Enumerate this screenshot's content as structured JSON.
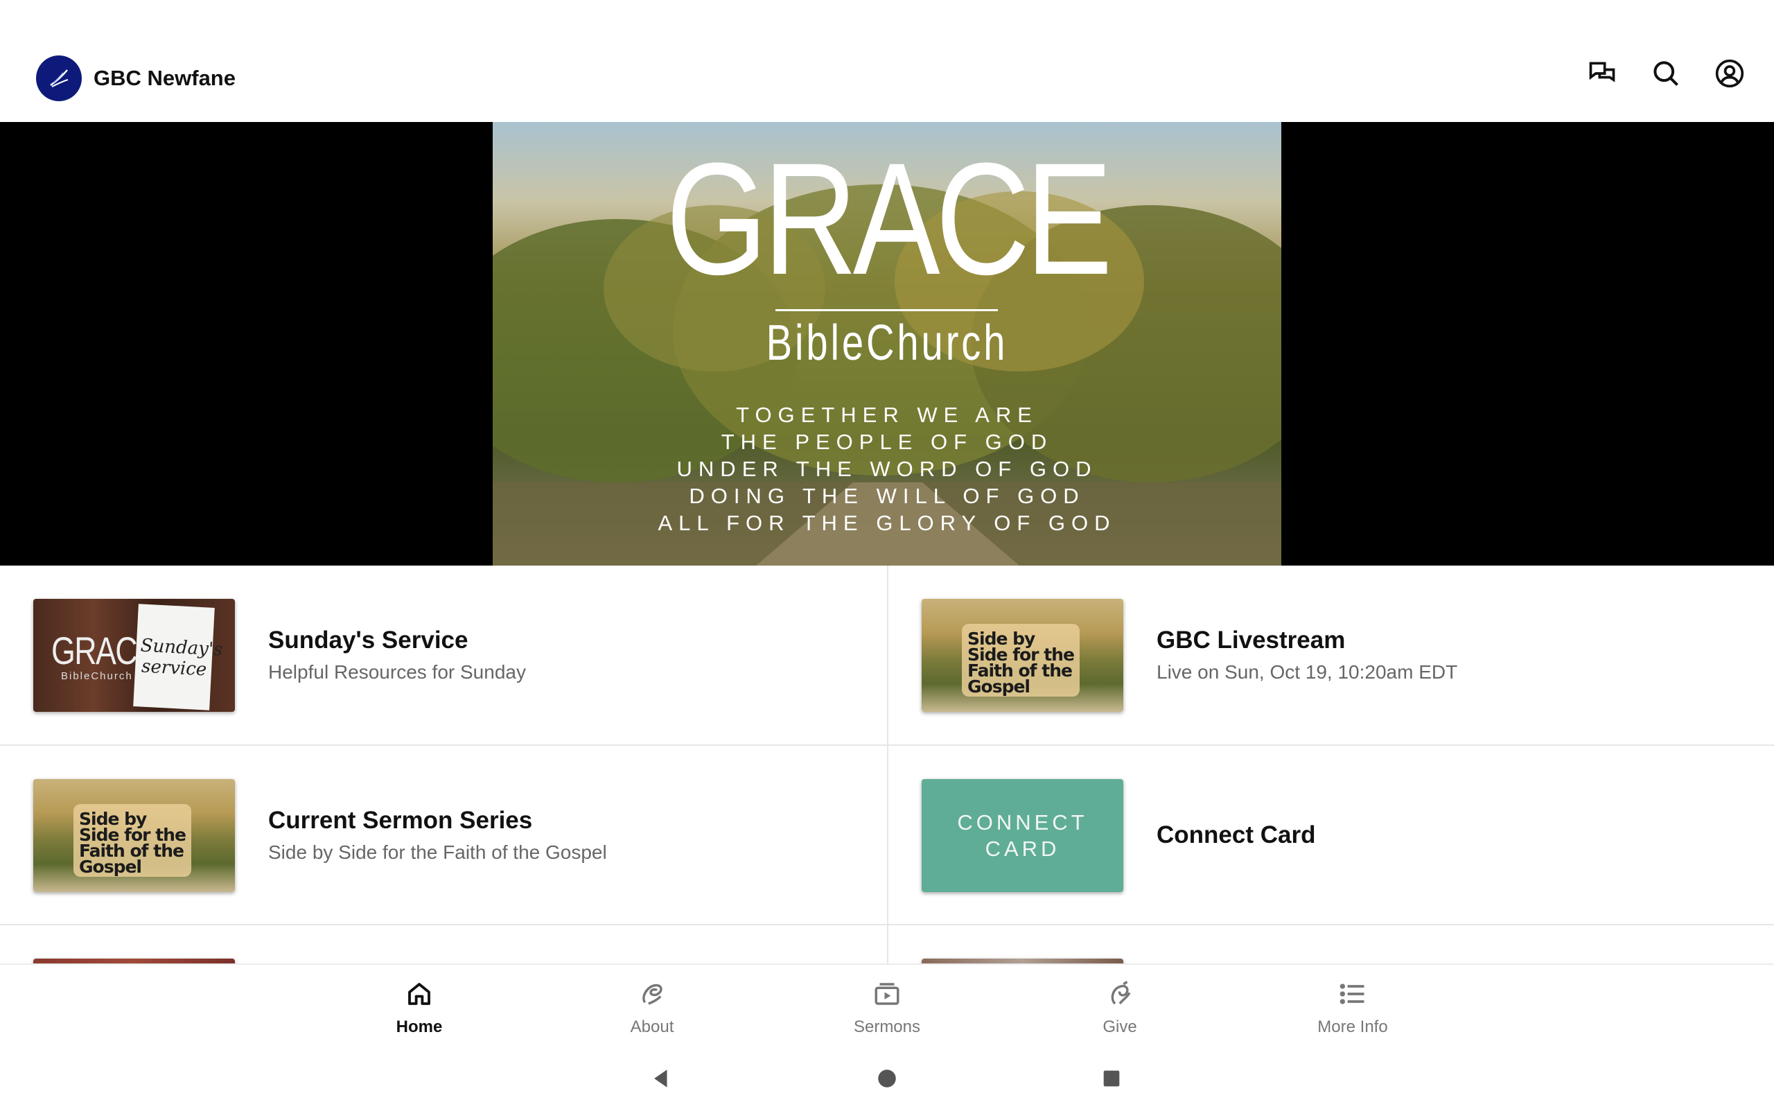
{
  "app": {
    "title": "GBC Newfane",
    "logo_icon": "church-logo-icon",
    "top_actions": [
      {
        "name": "messages-button",
        "icon": "chat-bubbles-icon"
      },
      {
        "name": "search-button",
        "icon": "search-icon"
      },
      {
        "name": "account-button",
        "icon": "account-circle-icon"
      }
    ]
  },
  "hero": {
    "title": "GRACE",
    "subtitle": "BibleChurch",
    "motto": [
      "TOGETHER WE ARE",
      "THE PEOPLE OF GOD",
      "UNDER THE WORD OF GOD",
      "DOING THE WILL OF GOD",
      "ALL FOR THE GLORY OF GOD"
    ]
  },
  "items": [
    {
      "title": "Sunday's Service",
      "subtitle": "Helpful Resources for Sunday",
      "thumb": {
        "word": "GRACE",
        "sub": "BibleChurch",
        "note": "Sunday's service"
      }
    },
    {
      "title": "GBC Livestream",
      "subtitle": "Live on Sun, Oct 19, 10:20am EDT",
      "thumb": {
        "badge": "Side by Side for the Faith of the Gospel"
      }
    },
    {
      "title": "Current Sermon Series",
      "subtitle": "Side by Side for the Faith of the Gospel",
      "thumb": {
        "badge": "Side by Side for the Faith of the Gospel"
      }
    },
    {
      "title": "Connect Card",
      "subtitle": "",
      "thumb": {
        "line1": "CONNECT",
        "line2": "CARD"
      }
    }
  ],
  "bottom_nav": [
    {
      "label": "Home",
      "icon": "home-icon",
      "active": true
    },
    {
      "label": "About",
      "icon": "about-swirl-icon",
      "active": false
    },
    {
      "label": "Sermons",
      "icon": "video-play-icon",
      "active": false
    },
    {
      "label": "Give",
      "icon": "give-swirl-icon",
      "active": false
    },
    {
      "label": "More Info",
      "icon": "list-icon",
      "active": false
    }
  ],
  "colors": {
    "logo_bg": "#0e1a7a",
    "connect_card": "#5fad96",
    "active_nav": "#111111",
    "inactive_nav": "#777777"
  }
}
